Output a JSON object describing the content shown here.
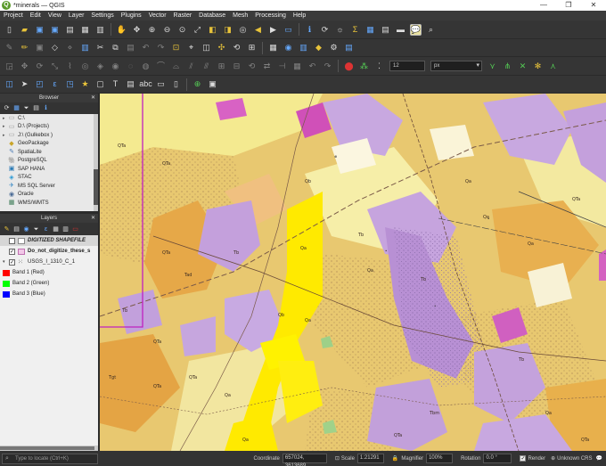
{
  "window": {
    "title": "*minerals — QGIS",
    "logo_letter": "Q",
    "minimize": "—",
    "maximize": "❐",
    "close": "✕"
  },
  "menu": [
    "Project",
    "Edit",
    "View",
    "Layer",
    "Settings",
    "Plugins",
    "Vector",
    "Raster",
    "Database",
    "Mesh",
    "Processing",
    "Help"
  ],
  "toolbar": {
    "tolerance_value": "12",
    "tolerance_unit": "px"
  },
  "browser": {
    "title": "Browser",
    "items": [
      {
        "label": "C:\\",
        "icon": "folder-icon"
      },
      {
        "label": "D:\\ (Projects)",
        "icon": "folder-icon"
      },
      {
        "label": "J:\\ (Gulkebox )",
        "icon": "folder-icon"
      },
      {
        "label": "GeoPackage",
        "icon": "geopackage-icon"
      },
      {
        "label": "SpatiaLite",
        "icon": "spatialite-icon"
      },
      {
        "label": "PostgreSQL",
        "icon": "postgresql-icon"
      },
      {
        "label": "SAP HANA",
        "icon": "sap-hana-icon"
      },
      {
        "label": "STAC",
        "icon": "stac-icon"
      },
      {
        "label": "MS SQL Server",
        "icon": "mssql-icon"
      },
      {
        "label": "Oracle",
        "icon": "oracle-icon"
      },
      {
        "label": "WMS/WMTS",
        "icon": "wms-icon"
      }
    ]
  },
  "layers": {
    "title": "Layers",
    "items": [
      {
        "label": "DIGITIZED SHAPEFILE",
        "checked": false,
        "swatch": "#ffffff",
        "style": "italic-bold"
      },
      {
        "label": "Do_not_digitize_these_s",
        "checked": true,
        "swatch": "#f2c8e8",
        "style": "bold"
      },
      {
        "label": "USGS_I_1310_C_1",
        "checked": true,
        "swatch": "",
        "style": "normal"
      }
    ],
    "bands": [
      {
        "label": "Band 1 (Red)",
        "color": "#ff0000"
      },
      {
        "label": "Band 2 (Green)",
        "color": "#00ff00"
      },
      {
        "label": "Band 3 (Blue)",
        "color": "#0000ff"
      }
    ]
  },
  "status": {
    "locator_placeholder": "Type to locate (Ctrl+K)",
    "coordinate_label": "Coordinate",
    "coordinate_value": "657024, 3613689",
    "scale_label": "Scale",
    "scale_value": "1:21291",
    "magnifier_label": "Magnifier",
    "magnifier_value": "100%",
    "rotation_label": "Rotation",
    "rotation_value": "0.0 °",
    "render_label": "Render",
    "crs_label": "Unknown CRS"
  }
}
